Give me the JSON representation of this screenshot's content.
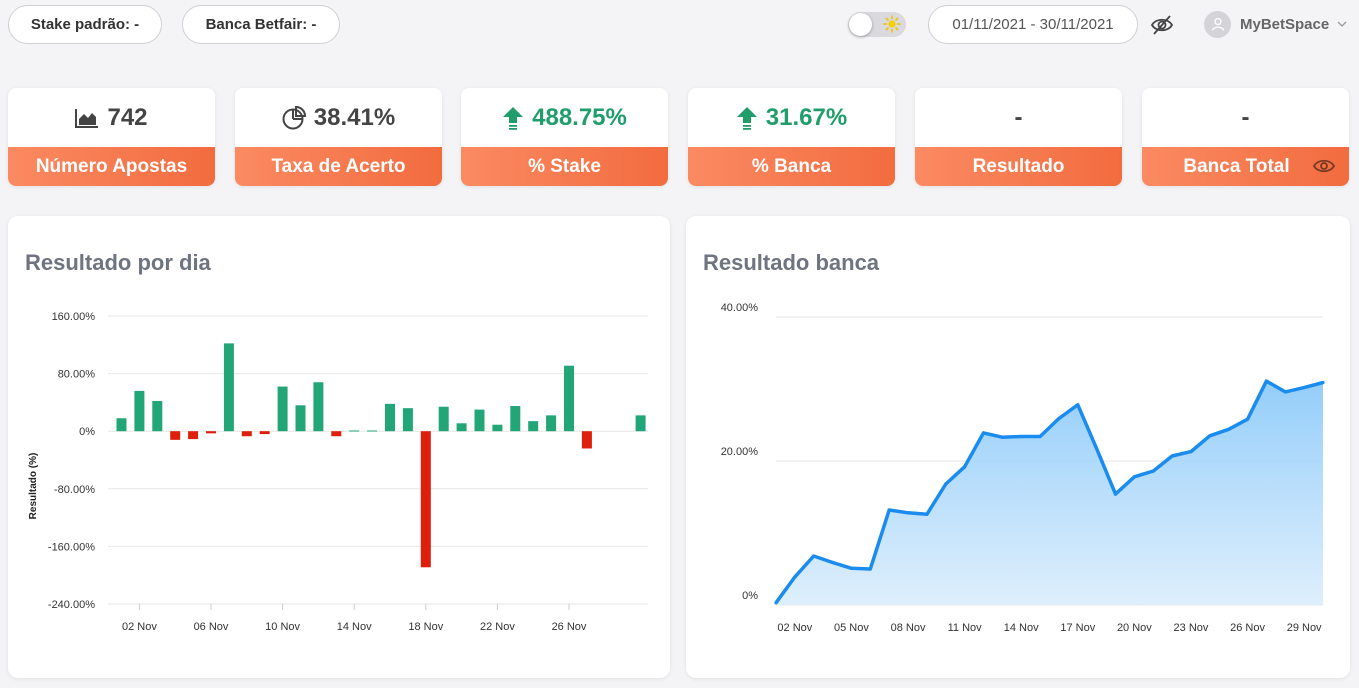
{
  "topbar": {
    "stake_label": "Stake padrão: -",
    "banca_label": "Banca Betfair: -",
    "date_range": "01/11/2021 - 30/11/2021",
    "user_name": "MyBetSpace",
    "theme_toggle_icon": "sun-icon",
    "hide_values_icon": "eye-off-icon"
  },
  "cards": [
    {
      "value": "742",
      "label": "Número Apostas",
      "icon": "area-chart-icon"
    },
    {
      "value": "38.41%",
      "label": "Taxa de Acerto",
      "icon": "pie-chart-icon"
    },
    {
      "value": "488.75%",
      "label": "% Stake",
      "icon": "arrow-up-icon"
    },
    {
      "value": "31.67%",
      "label": "% Banca",
      "icon": "arrow-up-icon"
    },
    {
      "value": "-",
      "label": "Resultado"
    },
    {
      "value": "-",
      "label": "Banca Total",
      "icon": "eye-icon"
    }
  ],
  "colors": {
    "positive": "#23a677",
    "negative": "#dd1f0b",
    "line": "#1a8cf0",
    "accent": "#f26c3f"
  },
  "panels": {
    "left_title": "Resultado por dia",
    "right_title": "Resultado banca"
  },
  "chart_data": [
    {
      "type": "bar",
      "title": "Resultado por dia",
      "ylabel": "Resultado (%)",
      "ylim": [
        -240,
        160
      ],
      "yticks": [
        "160.00%",
        "80.00%",
        "0%",
        "-80.00%",
        "-160.00%",
        "-240.00%"
      ],
      "xticks": [
        "02 Nov",
        "06 Nov",
        "10 Nov",
        "14 Nov",
        "18 Nov",
        "22 Nov",
        "26 Nov"
      ],
      "categories": [
        "01 Nov",
        "02 Nov",
        "03 Nov",
        "04 Nov",
        "05 Nov",
        "06 Nov",
        "07 Nov",
        "08 Nov",
        "09 Nov",
        "10 Nov",
        "11 Nov",
        "12 Nov",
        "13 Nov",
        "14 Nov",
        "15 Nov",
        "16 Nov",
        "17 Nov",
        "18 Nov",
        "19 Nov",
        "20 Nov",
        "21 Nov",
        "22 Nov",
        "23 Nov",
        "24 Nov",
        "25 Nov",
        "26 Nov",
        "27 Nov",
        "28 Nov",
        "29 Nov",
        "30 Nov"
      ],
      "values": [
        18,
        56,
        42,
        -12,
        -11,
        -3,
        122,
        -7,
        -4,
        62,
        36,
        68,
        -7,
        1,
        1,
        38,
        32,
        -189,
        34,
        11,
        30,
        9,
        35,
        14,
        22,
        91,
        -24,
        null,
        null,
        22
      ]
    },
    {
      "type": "area",
      "title": "Resultado banca",
      "ylim": [
        0,
        40
      ],
      "yticks": [
        "40.00%",
        "20.00%",
        "0%"
      ],
      "xticks": [
        "02 Nov",
        "05 Nov",
        "08 Nov",
        "11 Nov",
        "14 Nov",
        "17 Nov",
        "20 Nov",
        "23 Nov",
        "26 Nov",
        "29 Nov"
      ],
      "x": [
        "01 Nov",
        "02 Nov",
        "03 Nov",
        "04 Nov",
        "05 Nov",
        "06 Nov",
        "07 Nov",
        "08 Nov",
        "09 Nov",
        "10 Nov",
        "11 Nov",
        "12 Nov",
        "13 Nov",
        "14 Nov",
        "15 Nov",
        "16 Nov",
        "17 Nov",
        "18 Nov",
        "19 Nov",
        "20 Nov",
        "21 Nov",
        "22 Nov",
        "23 Nov",
        "24 Nov",
        "25 Nov",
        "26 Nov",
        "27 Nov",
        "28 Nov",
        "29 Nov",
        "30 Nov"
      ],
      "values": [
        0.3,
        3.9,
        6.8,
        5.9,
        5.1,
        5.0,
        13.2,
        12.8,
        12.6,
        16.8,
        19.2,
        23.9,
        23.3,
        23.4,
        23.4,
        25.9,
        27.8,
        21.7,
        15.4,
        17.8,
        18.6,
        20.7,
        21.3,
        23.5,
        24.4,
        25.8,
        31.1,
        29.6,
        30.2,
        30.9
      ]
    }
  ]
}
